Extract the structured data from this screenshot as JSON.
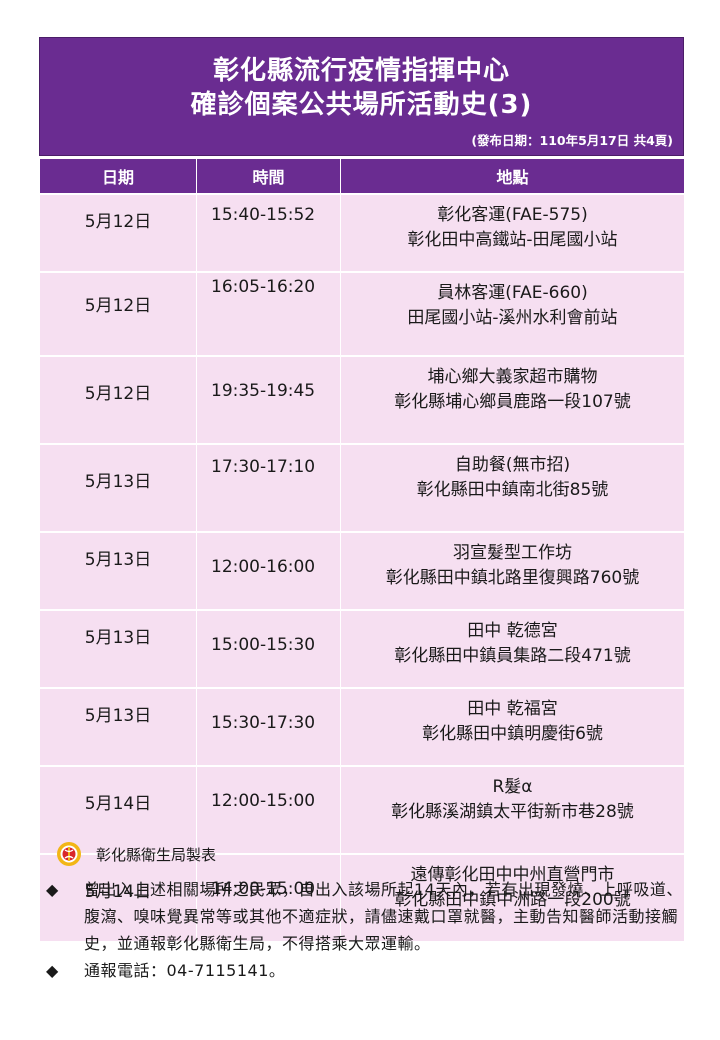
{
  "header": {
    "title_line1": "彰化縣流行疫情指揮中心",
    "title_line2": "確診個案公共場所活動史(3)",
    "publish_note": "(發布日期：110年5月17日 共4頁)"
  },
  "table": {
    "columns": [
      "日期",
      "時間",
      "地點"
    ],
    "rows": [
      {
        "date": "5月12日",
        "time": "15:40-15:52",
        "place1": "彰化客運(FAE-575)",
        "place2": "彰化田中高鐵站-田尾國小站"
      },
      {
        "date": "5月12日",
        "time": "16:05-16:20",
        "place1": "員林客運(FAE-660)",
        "place2": "田尾國小站-溪州水利會前站"
      },
      {
        "date": "5月12日",
        "time": "19:35-19:45",
        "place1": "埔心鄉大義家超市購物",
        "place2": "彰化縣埔心鄉員鹿路一段107號"
      },
      {
        "date": "5月13日",
        "time": "17:30-17:10",
        "place1": "自助餐(無市招)",
        "place2": "彰化縣田中鎮南北街85號"
      },
      {
        "date": "5月13日",
        "time": "12:00-16:00",
        "place1": "羽宣髮型工作坊",
        "place2": "彰化縣田中鎮北路里復興路760號"
      },
      {
        "date": "5月13日",
        "time": "15:00-15:30",
        "place1": "田中 乾德宮",
        "place2": "彰化縣田中鎮員集路二段471號"
      },
      {
        "date": "5月13日",
        "time": "15:30-17:30",
        "place1": "田中 乾福宮",
        "place2": "彰化縣田中鎮明慶街6號"
      },
      {
        "date": "5月14日",
        "time": "12:00-15:00",
        "place1": "R髮α",
        "place2": "彰化縣溪湖鎮太平街新市巷28號"
      },
      {
        "date": "5月14日",
        "time": "14:00-15:00",
        "place1": "遠傳彰化田中中州直營門市",
        "place2": "彰化縣田中鎮中洲路一段200號"
      }
    ]
  },
  "footer": {
    "maker": "彰化縣衛生局製表",
    "note1": "曾出入上述相關場所之民眾，自出入該場所起14天內，若有出現發燒、上呼吸道、腹瀉、嗅味覺異常等或其他不適症狀，請儘速戴口罩就醫，主動告知醫師活動接觸史，並通報彰化縣衛生局，不得搭乘大眾運輸。",
    "note2": "通報電話：04-7115141。",
    "bullet": "◆"
  },
  "colors": {
    "header_purple": "#6a2c91",
    "row_pink": "#f6dff1"
  }
}
